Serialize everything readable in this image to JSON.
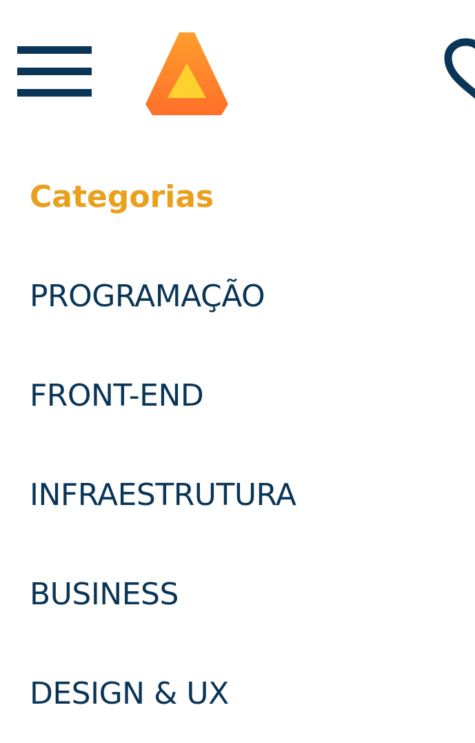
{
  "colors": {
    "navy": "#0a3557",
    "accent_heading": "#eaa01d",
    "logo_outer_top": "#ff9e2c",
    "logo_outer_bottom": "#ff6f2a",
    "logo_inner": "#ffd12f"
  },
  "header": {
    "menu_icon": "hamburger-menu-icon",
    "logo_icon": "triangle-logo-icon",
    "favorite_icon": "heart-icon"
  },
  "menu": {
    "heading": "Categorias",
    "items": [
      {
        "label": "PROGRAMAÇÃO"
      },
      {
        "label": "FRONT-END"
      },
      {
        "label": "INFRAESTRUTURA"
      },
      {
        "label": "BUSINESS"
      },
      {
        "label": "DESIGN & UX"
      }
    ]
  }
}
